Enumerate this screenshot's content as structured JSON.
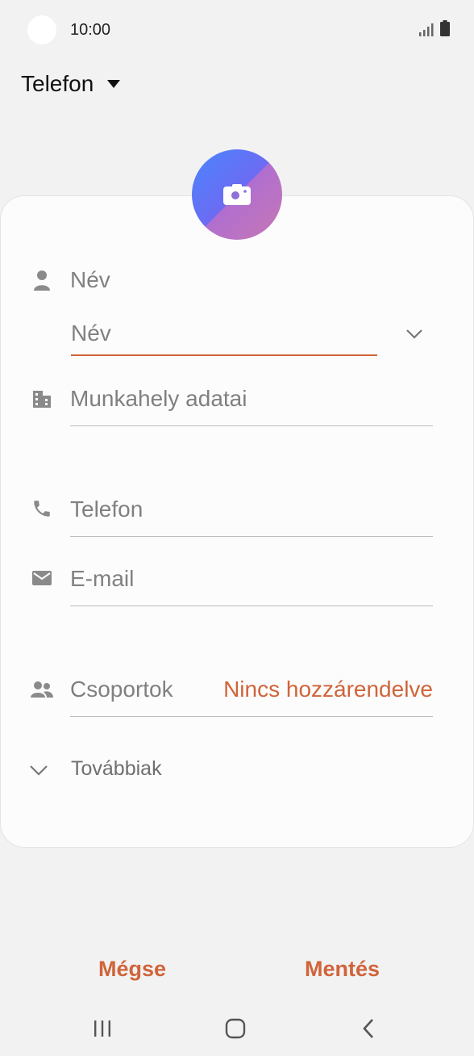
{
  "status_bar": {
    "time": "10:00"
  },
  "header": {
    "account_label": "Telefon"
  },
  "form": {
    "name_section_label": "Név",
    "name_input_placeholder": "Név",
    "work_placeholder": "Munkahely adatai",
    "phone_placeholder": "Telefon",
    "email_placeholder": "E-mail",
    "groups_label": "Csoportok",
    "groups_value": "Nincs hozzárendelve",
    "more_label": "Továbbiak"
  },
  "actions": {
    "cancel": "Mégse",
    "save": "Mentés"
  },
  "colors": {
    "accent": "#d0643a",
    "background": "#f2f2f2",
    "card": "#fcfcfc"
  }
}
